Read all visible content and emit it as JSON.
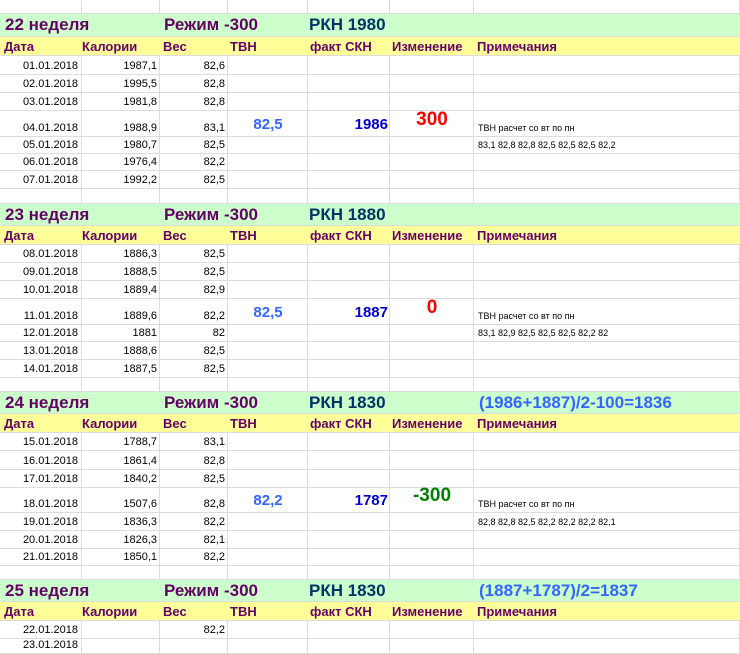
{
  "headers": {
    "date": "Дата",
    "calories": "Калории",
    "weight": "Вес",
    "tvn": "ТВН",
    "fact": "факт СКН",
    "change": "Изменение",
    "notes": "Примечания"
  },
  "weeks": [
    {
      "title": "22  неделя",
      "mode": "Режим -300",
      "rkn": "РКН  1980",
      "formula": "",
      "tvn": "82,5",
      "skn": "1986",
      "change": "300",
      "change_color": "#ff0000",
      "note1": "ТВН расчет со вт по пн",
      "note2": "83,1  82,8  82,8  82,5  82,5  82,5  82,2",
      "rows": [
        {
          "date": "01.01.2018",
          "cal": "1987,1",
          "w": "82,6"
        },
        {
          "date": "02.01.2018",
          "cal": "1995,5",
          "w": "82,8"
        },
        {
          "date": "03.01.2018",
          "cal": "1981,8",
          "w": "82,8"
        },
        {
          "date": "04.01.2018",
          "cal": "1988,9",
          "w": "83,1"
        },
        {
          "date": "05.01.2018",
          "cal": "1980,7",
          "w": "82,5"
        },
        {
          "date": "06.01.2018",
          "cal": "1976,4",
          "w": "82,2"
        },
        {
          "date": "07.01.2018",
          "cal": "1992,2",
          "w": "82,5"
        }
      ]
    },
    {
      "title": "23  неделя",
      "mode": "Режим -300",
      "rkn": "РКН 1880",
      "formula": "",
      "tvn": "82,5",
      "skn": "1887",
      "change": "0",
      "change_color": "#ff0000",
      "note1": "ТВН расчет со вт по пн",
      "note2": "83,1  82,9  82,5  82,5  82,5  82,2  82",
      "rows": [
        {
          "date": "08.01.2018",
          "cal": "1886,3",
          "w": "82,5"
        },
        {
          "date": "09.01.2018",
          "cal": "1888,5",
          "w": "82,5"
        },
        {
          "date": "10.01.2018",
          "cal": "1889,4",
          "w": "82,9"
        },
        {
          "date": "11.01.2018",
          "cal": "1889,6",
          "w": "82,2"
        },
        {
          "date": "12.01.2018",
          "cal": "1881",
          "w": "82"
        },
        {
          "date": "13.01.2018",
          "cal": "1888,6",
          "w": "82,5"
        },
        {
          "date": "14.01.2018",
          "cal": "1887,5",
          "w": "82,5"
        }
      ]
    },
    {
      "title": "24  неделя",
      "mode": "Режим -300",
      "rkn": "РКН 1830",
      "formula": "(1986+1887)/2-100=1836",
      "tvn": "82,2",
      "skn": "1787",
      "change": "-300",
      "change_color": "#008000",
      "note1": "ТВН расчет со вт по пн",
      "note2": "82,8  82,8  82,5  82,2  82,2  82,2  82,1",
      "rows": [
        {
          "date": "15.01.2018",
          "cal": "1788,7",
          "w": "83,1"
        },
        {
          "date": "16.01.2018",
          "cal": "1861,4",
          "w": "82,8"
        },
        {
          "date": "17.01.2018",
          "cal": "1840,2",
          "w": "82,5"
        },
        {
          "date": "18.01.2018",
          "cal": "1507,6",
          "w": "82,8"
        },
        {
          "date": "19.01.2018",
          "cal": "1836,3",
          "w": "82,2"
        },
        {
          "date": "20.01.2018",
          "cal": "1826,3",
          "w": "82,1"
        },
        {
          "date": "21.01.2018",
          "cal": "1850,1",
          "w": "82,2"
        }
      ]
    },
    {
      "title": "25  неделя",
      "mode": "Режим -300",
      "rkn": "РКН  1830",
      "formula": "(1887+1787)/2=1837",
      "tvn": "",
      "skn": "",
      "change": "",
      "change_color": "#ff0000",
      "note1": "",
      "note2": "",
      "rows": [
        {
          "date": "22.01.2018",
          "cal": "",
          "w": "82,2"
        },
        {
          "date": "23.01.2018",
          "cal": "",
          "w": ""
        }
      ]
    }
  ]
}
